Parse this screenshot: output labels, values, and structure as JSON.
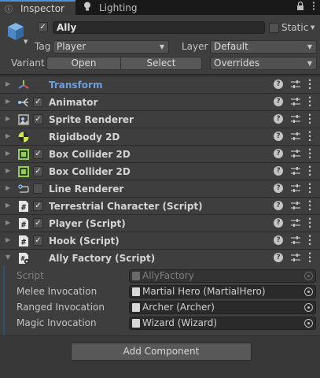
{
  "tabs": [
    {
      "label": "Inspector",
      "icon": "info-icon"
    },
    {
      "label": "Lighting",
      "icon": "bulb-icon"
    }
  ],
  "header": {
    "name": "Ally",
    "active": true,
    "static_label": "Static",
    "static": false,
    "tag_label": "Tag",
    "tag_value": "Player",
    "layer_label": "Layer",
    "layer_value": "Default",
    "variant_label": "Variant",
    "open_label": "Open",
    "select_label": "Select",
    "overrides_label": "Overrides"
  },
  "components": [
    {
      "name": "Transform",
      "icon": "transform-icon",
      "checkbox": false,
      "highlight": true
    },
    {
      "name": "Animator",
      "icon": "animator-icon",
      "checkbox": true,
      "checked": true
    },
    {
      "name": "Sprite Renderer",
      "icon": "sprite-renderer-icon",
      "checkbox": true,
      "checked": true
    },
    {
      "name": "Rigidbody 2D",
      "icon": "rigidbody-icon",
      "checkbox": false
    },
    {
      "name": "Box Collider 2D",
      "icon": "box-collider-icon",
      "checkbox": true,
      "checked": true
    },
    {
      "name": "Box Collider 2D",
      "icon": "box-collider-icon",
      "checkbox": true,
      "checked": true
    },
    {
      "name": "Line Renderer",
      "icon": "line-renderer-icon",
      "checkbox": true,
      "checked": false
    },
    {
      "name": "Terrestrial Character (Script)",
      "icon": "script-icon",
      "checkbox": true,
      "checked": true
    },
    {
      "name": "Player (Script)",
      "icon": "script-icon",
      "checkbox": true,
      "checked": true
    },
    {
      "name": "Hook (Script)",
      "icon": "script-icon",
      "checkbox": true,
      "checked": true
    },
    {
      "name": "Ally Factory (Script)",
      "icon": "script-gear-icon",
      "checkbox": false,
      "expanded": true
    }
  ],
  "fields": [
    {
      "label": "Script",
      "value": "AllyFactory",
      "disabled": true
    },
    {
      "label": "Melee Invocation",
      "value": "Martial Hero (MartialHero)"
    },
    {
      "label": "Ranged Invocation",
      "value": "Archer (Archer)"
    },
    {
      "label": "Magic Invocation",
      "value": "Wizard (Wizard)"
    }
  ],
  "add_component_label": "Add Component",
  "colors": {
    "background": "#383838",
    "header": "#3e3e3e",
    "accent": "#4a90d9",
    "transform_label": "#6a9fe0"
  }
}
